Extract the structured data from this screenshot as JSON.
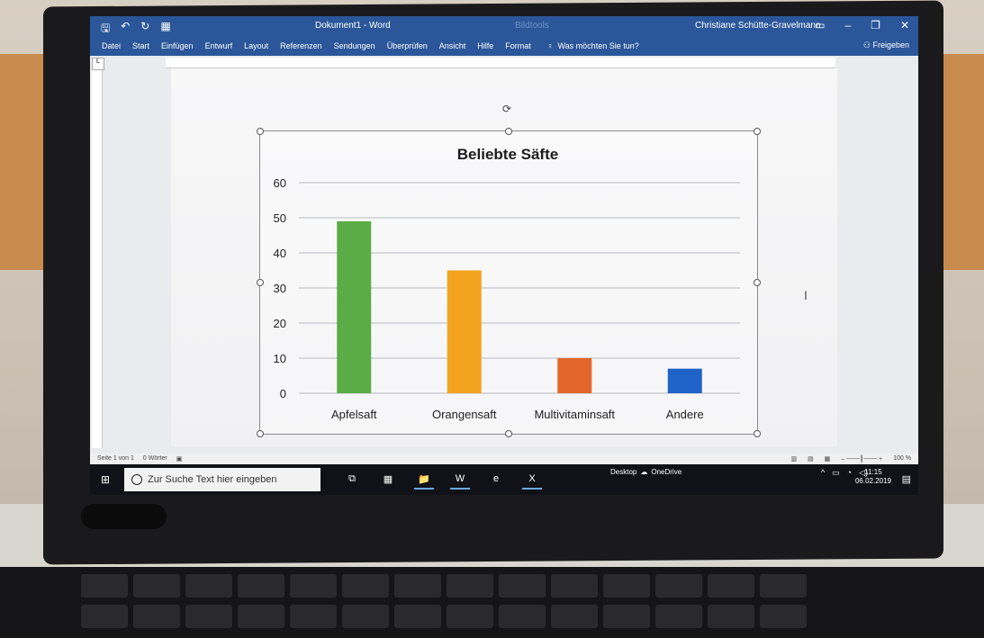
{
  "word": {
    "title": "Dokument1 - Word",
    "context_tab": "Bildtools",
    "user": "Christiane Schütte-Gravelmann",
    "tabs": [
      "Datei",
      "Start",
      "Einfügen",
      "Entwurf",
      "Layout",
      "Referenzen",
      "Sendungen",
      "Überprüfen",
      "Ansicht",
      "Hilfe",
      "Format"
    ],
    "tell_me": "Was möchten Sie tun?",
    "share": "Freigeben",
    "status_page": "Seite 1 von 1",
    "status_words": "0 Wörter",
    "zoom": "100 %"
  },
  "taskbar": {
    "search_placeholder": "Zur Suche Text hier eingeben",
    "desktop_label": "Desktop",
    "onedrive_label": "OneDrive",
    "time": "11:15",
    "date": "06.02.2019"
  },
  "colors": {
    "titlebar": "#2b579a",
    "apfelsaft": "#5aad46",
    "orangensaft": "#f2a21e",
    "multivitaminsaft": "#e2662a",
    "andere": "#1f63c9"
  },
  "chart_data": {
    "type": "bar",
    "title": "Beliebte Säfte",
    "categories": [
      "Apfelsaft",
      "Orangensaft",
      "Multivitaminsaft",
      "Andere"
    ],
    "values": [
      49,
      35,
      10,
      7
    ],
    "ylim": [
      0,
      60
    ],
    "yticks": [
      0,
      10,
      20,
      30,
      40,
      50,
      60
    ],
    "bar_colors": [
      "#5aad46",
      "#f2a21e",
      "#e2662a",
      "#1f63c9"
    ],
    "grid": true,
    "legend": "none"
  }
}
